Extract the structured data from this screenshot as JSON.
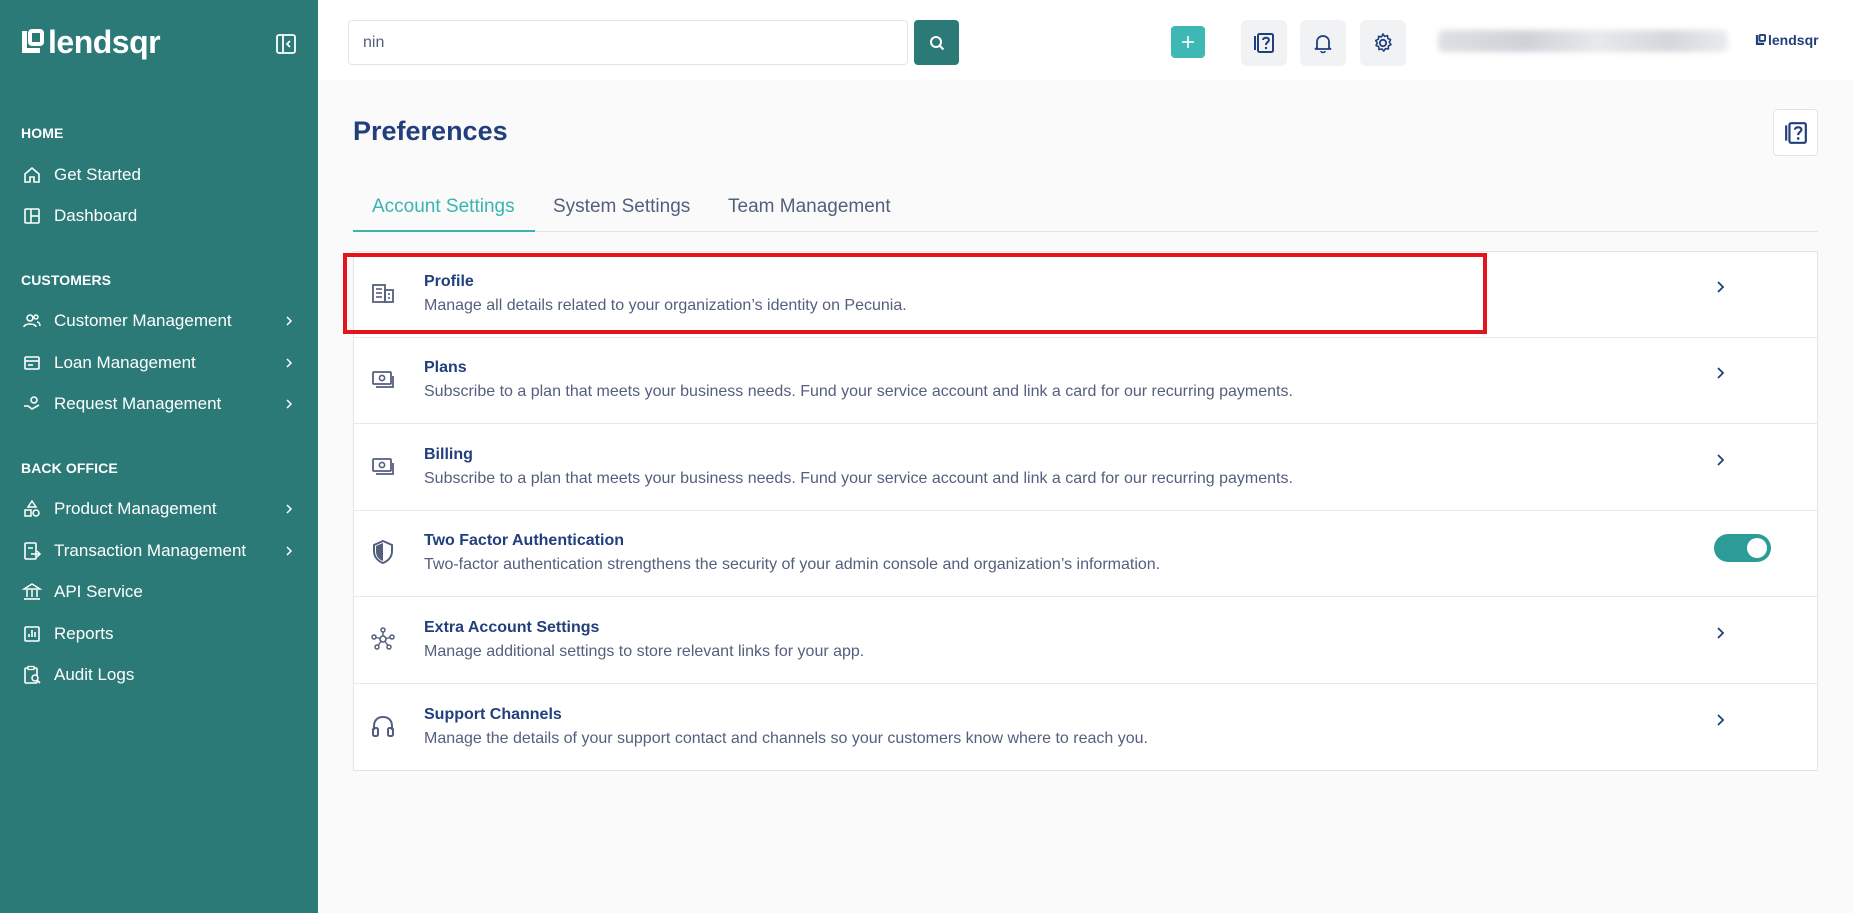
{
  "brand": {
    "name": "lendsqr"
  },
  "search": {
    "value": "nin",
    "placeholder": ""
  },
  "sidebar": {
    "sections": [
      {
        "title": "HOME"
      },
      {
        "title": "CUSTOMERS"
      },
      {
        "title": "BACK OFFICE"
      }
    ],
    "items": [
      {
        "label": "Get Started",
        "icon": "home-icon"
      },
      {
        "label": "Dashboard",
        "icon": "dashboard-icon"
      },
      {
        "label": "Customer Management",
        "icon": "users-icon"
      },
      {
        "label": "Loan Management",
        "icon": "loan-icon"
      },
      {
        "label": "Request Management",
        "icon": "request-icon"
      },
      {
        "label": "Product Management",
        "icon": "product-icon"
      },
      {
        "label": "Transaction Management",
        "icon": "transaction-icon"
      },
      {
        "label": "API Service",
        "icon": "bank-icon"
      },
      {
        "label": "Reports",
        "icon": "reports-icon"
      },
      {
        "label": "Audit Logs",
        "icon": "audit-icon"
      }
    ]
  },
  "header": {
    "logo_text": "lendsqr"
  },
  "main": {
    "title": "Preferences",
    "tabs": [
      {
        "label": "Account Settings",
        "active": true
      },
      {
        "label": "System Settings",
        "active": false
      },
      {
        "label": "Team Management",
        "active": false
      }
    ],
    "settings": [
      {
        "title": "Profile",
        "description": "Manage all details related to your organization’s identity on Pecunia.",
        "icon": "building-icon"
      },
      {
        "title": "Plans",
        "description": "Subscribe to a plan that meets your business needs. Fund your service account and link a card for our recurring payments.",
        "icon": "money-icon"
      },
      {
        "title": "Billing",
        "description": "Subscribe to a plan that meets your business needs. Fund your service account and link a card for our recurring payments.",
        "icon": "money-icon"
      },
      {
        "title": "Two Factor Authentication",
        "description": "Two-factor authentication strengthens the security of your admin console and organization’s information.",
        "icon": "shield-icon",
        "toggle_on": true
      },
      {
        "title": "Extra Account Settings",
        "description": "Manage additional settings to store relevant links for your app.",
        "icon": "network-icon"
      },
      {
        "title": "Support Channels",
        "description": "Manage the details of your support contact and channels so your customers know where to reach you.",
        "icon": "headphones-icon"
      }
    ]
  },
  "colors": {
    "sidebar": "#2b7a78",
    "accent": "#39b5b0",
    "text": "#213f7d",
    "highlight": "#e3141b"
  }
}
